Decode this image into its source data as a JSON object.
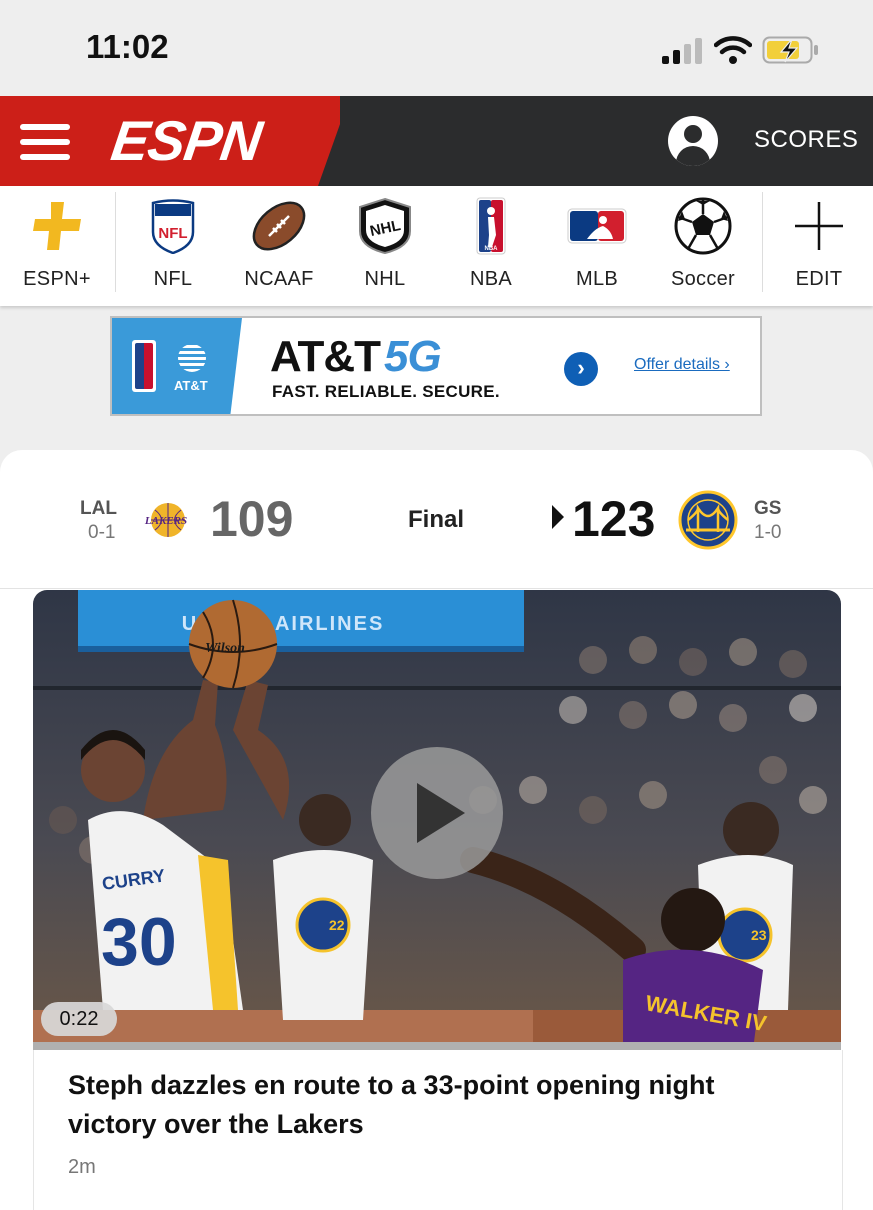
{
  "status_bar": {
    "time": "11:02"
  },
  "header": {
    "logo": "ESPN",
    "scores_label": "SCORES",
    "accent_color": "#cc1f18"
  },
  "nav": {
    "items": [
      {
        "label": "ESPN+",
        "icon": "plus-icon"
      },
      {
        "label": "NFL",
        "icon": "nfl-logo-icon"
      },
      {
        "label": "NCAAF",
        "icon": "football-icon"
      },
      {
        "label": "NHL",
        "icon": "nhl-logo-icon"
      },
      {
        "label": "NBA",
        "icon": "nba-logo-icon"
      },
      {
        "label": "MLB",
        "icon": "mlb-logo-icon"
      },
      {
        "label": "Soccer",
        "icon": "soccer-ball-icon"
      },
      {
        "label": "EDIT",
        "icon": "add-icon"
      }
    ]
  },
  "ad": {
    "brand_small": "AT&T",
    "headline": "AT&T",
    "headline_accent": "5G",
    "tagline": "FAST. RELIABLE. SECURE.",
    "cta": "Offer details ›"
  },
  "scoreboard": {
    "status": "Final",
    "away": {
      "abbr": "LAL",
      "record": "0-1",
      "score": "109",
      "logo_text": "LAKERS"
    },
    "home": {
      "abbr": "GS",
      "record": "1-0",
      "score": "123"
    }
  },
  "video": {
    "duration": "0:22",
    "arena_banner": "UNITED AIRLINES",
    "player_name": "CURRY",
    "player_number": "30",
    "opponent_name": "WALKER IV",
    "jersey_numbers": [
      "22",
      "23"
    ],
    "ball_brand": "Wilson"
  },
  "story": {
    "headline": "Steph dazzles en route to a 33-point opening night victory over the Lakers",
    "time_ago": "2m"
  }
}
